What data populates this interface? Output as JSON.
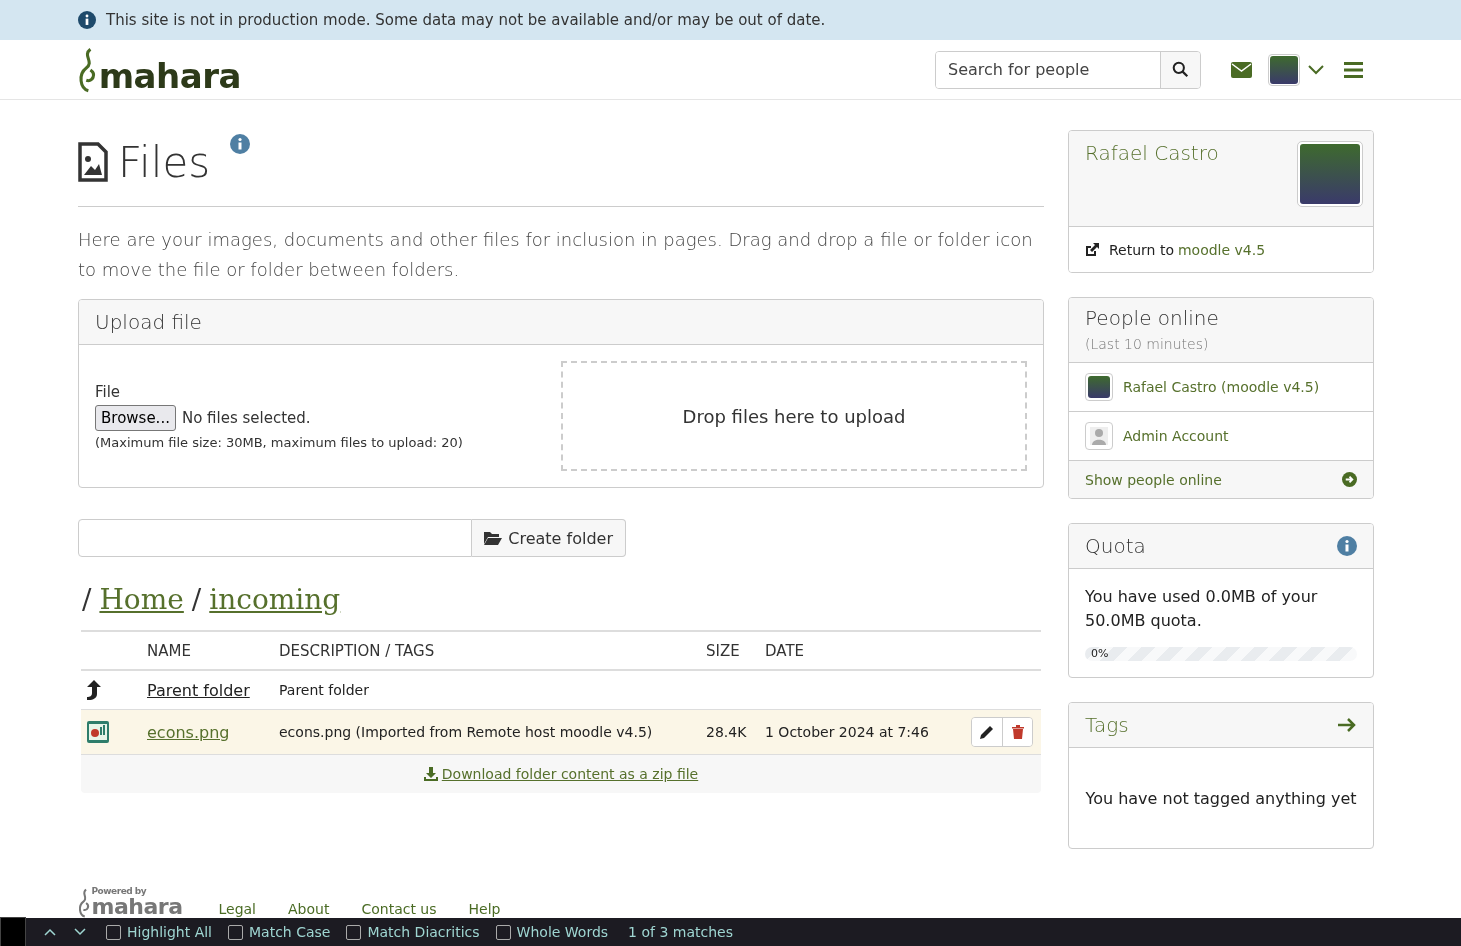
{
  "banner": {
    "text": "This site is not in production mode. Some data may not be available and/or may be out of date."
  },
  "header": {
    "logo": "mahara",
    "search": {
      "placeholder": "Search for people"
    }
  },
  "page": {
    "title": "Files",
    "description": "Here are your images, documents and other files for inclusion in pages. Drag and drop a file or folder icon to move the file or folder between folders."
  },
  "upload": {
    "title": "Upload file",
    "field_label": "File",
    "browse": "Browse...",
    "status": "No files selected.",
    "note": "(Maximum file size: 30MB, maximum files to upload: 20)",
    "dropzone": "Drop files here to upload"
  },
  "create_folder": {
    "button": "Create folder"
  },
  "breadcrumb": [
    {
      "text": "/",
      "kind": "separator"
    },
    {
      "text": "Home",
      "kind": "link"
    },
    {
      "text": "/",
      "kind": "separator"
    },
    {
      "text": "incoming",
      "kind": "link"
    }
  ],
  "table": {
    "columns": [
      "NAME",
      "DESCRIPTION / TAGS",
      "SIZE",
      "DATE"
    ],
    "rows": [
      {
        "kind": "parent",
        "selected": false,
        "name": "Parent folder",
        "description": "Parent folder"
      },
      {
        "kind": "file",
        "selected": true,
        "name": "econs.png",
        "description": "econs.png (Imported from Remote host moodle v4.5)",
        "size": "28.4K",
        "date": "1 October 2024 at 7:46"
      }
    ],
    "download": "Download folder content as a zip file"
  },
  "profile": {
    "name": "Rafael Castro",
    "return_prefix": "Return to",
    "return_link": "moodle v4.5"
  },
  "people_online": {
    "title": "People online",
    "subtitle": "(Last 10 minutes)",
    "people": [
      {
        "name": "Rafael Castro (moodle v4.5)",
        "kind": "photo"
      },
      {
        "name": "Admin Account",
        "kind": "default"
      }
    ],
    "show": "Show people online"
  },
  "quota": {
    "title": "Quota",
    "text": "You have used 0.0MB of your 50.0MB quota.",
    "level": 0,
    "reading": "0%"
  },
  "tags": {
    "title": "Tags",
    "empty": "You have not tagged anything yet"
  },
  "footer": {
    "powered_by": "Powered by",
    "logo": "mahara",
    "links": [
      "Legal",
      "About",
      "Contact us",
      "Help"
    ]
  },
  "find_bar": {
    "options": [
      {
        "label": "Highlight All",
        "checked": false
      },
      {
        "label": "Match Case",
        "checked": false
      },
      {
        "label": "Match Diacritics",
        "checked": false
      },
      {
        "label": "Whole Words",
        "checked": false
      }
    ],
    "matches": "1 of 3 matches"
  }
}
